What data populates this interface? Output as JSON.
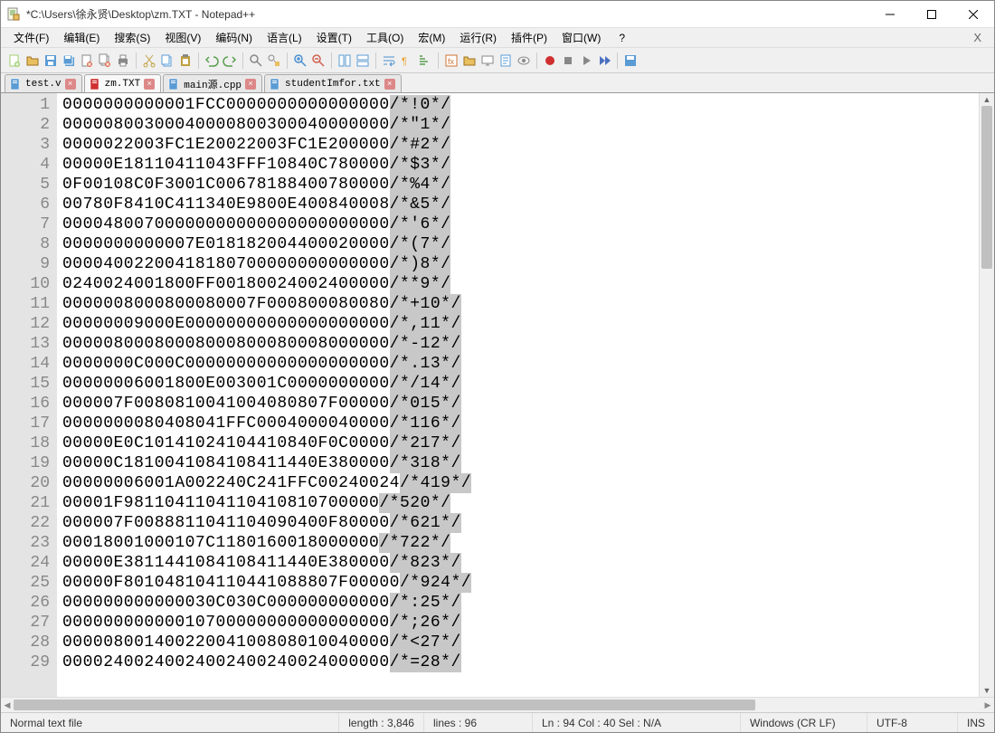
{
  "titlebar": {
    "title": "*C:\\Users\\徐永贤\\Desktop\\zm.TXT - Notepad++"
  },
  "menu": {
    "items": [
      "文件(F)",
      "编辑(E)",
      "搜索(S)",
      "视图(V)",
      "编码(N)",
      "语言(L)",
      "设置(T)",
      "工具(O)",
      "宏(M)",
      "运行(R)",
      "插件(P)",
      "窗口(W)"
    ],
    "help": "?"
  },
  "tabs": [
    {
      "label": "test.v",
      "active": false,
      "unsaved": false
    },
    {
      "label": "zm.TXT",
      "active": true,
      "unsaved": true
    },
    {
      "label": "main源.cpp",
      "active": false,
      "unsaved": false
    },
    {
      "label": "studentImfor.txt",
      "active": false,
      "unsaved": false
    }
  ],
  "lines": [
    {
      "n": 1,
      "hex": "0000000000001FCC0000000000000000",
      "c": "/*!0*/"
    },
    {
      "n": 2,
      "hex": "00000800300040000800300040000000",
      "c": "/*\"1*/"
    },
    {
      "n": 3,
      "hex": "0000022003FC1E20022003FC1E200000",
      "c": "/*#2*/"
    },
    {
      "n": 4,
      "hex": "00000E18110411043FFF10840C780000",
      "c": "/*$3*/"
    },
    {
      "n": 5,
      "hex": "0F00108C0F3001C00678188400780000",
      "c": "/*%4*/"
    },
    {
      "n": 6,
      "hex": "00780F8410C411340E9800E400840008",
      "c": "/*&5*/"
    },
    {
      "n": 7,
      "hex": "00004800700000000000000000000000",
      "c": "/*'6*/"
    },
    {
      "n": 8,
      "hex": "0000000000007E018182004400020000",
      "c": "/*(7*/"
    },
    {
      "n": 9,
      "hex": "00004002200418180700000000000000",
      "c": "/*)8*/"
    },
    {
      "n": 10,
      "hex": "0240024001800FF00180024002400000",
      "c": "/**9*/"
    },
    {
      "n": 11,
      "hex": "0000008000800080007F000800080080",
      "c": "/*+10*/"
    },
    {
      "n": 12,
      "hex": "00000009000E00000000000000000000",
      "c": "/*,11*/"
    },
    {
      "n": 13,
      "hex": "00000800080008000800080008000000",
      "c": "/*-12*/"
    },
    {
      "n": 14,
      "hex": "0000000C000C00000000000000000000",
      "c": "/*.13*/"
    },
    {
      "n": 15,
      "hex": "00000006001800E003001C0000000000",
      "c": "/*/14*/"
    },
    {
      "n": 16,
      "hex": "000007F0080810041004080807F00000",
      "c": "/*015*/"
    },
    {
      "n": 17,
      "hex": "0000000080408041FFC0004000040000",
      "c": "/*116*/"
    },
    {
      "n": 18,
      "hex": "00000E0C10141024104410840F0C0000",
      "c": "/*217*/"
    },
    {
      "n": 19,
      "hex": "00000C1810041084108411440E380000",
      "c": "/*318*/"
    },
    {
      "n": 20,
      "hex": "00000006001A002240C241FFC00240024",
      "c": "/*419*/"
    },
    {
      "n": 21,
      "hex": "00001F9811041104110410810700000",
      "c": "/*520*/"
    },
    {
      "n": 22,
      "hex": "000007F0088811041104090400F80000",
      "c": "/*621*/"
    },
    {
      "n": 23,
      "hex": "00018001000107C1180160018000000",
      "c": "/*722*/"
    },
    {
      "n": 24,
      "hex": "00000E3811441084108411440E380000",
      "c": "/*823*/"
    },
    {
      "n": 25,
      "hex": "00000F801048104110441088807F00000",
      "c": "/*924*/"
    },
    {
      "n": 26,
      "hex": "000000000000030C030C000000000000",
      "c": "/*:25*/"
    },
    {
      "n": 27,
      "hex": "00000000000010700000000000000000",
      "c": "/*;26*/"
    },
    {
      "n": 28,
      "hex": "00000800140022004100808010040000",
      "c": "/*<27*/"
    },
    {
      "n": 29,
      "hex": "00002400240024002400240024000000",
      "c": "/*=28*/"
    }
  ],
  "status": {
    "filetype": "Normal text file",
    "length": "length : 3,846",
    "lines": "lines : 96",
    "pos": "Ln : 94    Col : 40    Sel : N/A",
    "eol": "Windows (CR LF)",
    "enc": "UTF-8",
    "ins": "INS"
  },
  "toolbar_icons": [
    "new-file",
    "open-file",
    "save-file",
    "save-all",
    "close-file",
    "close-all",
    "print",
    "sep",
    "cut",
    "copy",
    "paste",
    "sep",
    "undo",
    "redo",
    "sep",
    "find",
    "replace",
    "sep",
    "zoom-in",
    "zoom-out",
    "sep",
    "sync-v",
    "sync-h",
    "sep",
    "wordwrap",
    "show-all",
    "indent-guide",
    "sep",
    "lang",
    "folder",
    "monitor",
    "doc",
    "eye",
    "sep",
    "record",
    "stop",
    "play",
    "play-multi",
    "sep",
    "save-macro"
  ],
  "colors": {
    "tb": {
      "new": "#9fcf6f",
      "open": "#e8c060",
      "save": "#5a9bd4",
      "saveall": "#5a9bd4",
      "close": "#e07050",
      "closeall": "#e07050",
      "print": "#888",
      "cut": "#c0a040",
      "copy": "#5a9bd4",
      "paste": "#c0a040",
      "undo": "#5aa050",
      "redo": "#5aa050",
      "find": "#888",
      "replace": "#888",
      "zin": "#4a90d0",
      "zout": "#d06050",
      "sv": "#5a9bd4",
      "sh": "#5a9bd4",
      "ww": "#4a90d0",
      "sa": "#e8a030",
      "ig": "#5aa050",
      "lang": "#d07030",
      "folder": "#e8c060",
      "mon": "#888",
      "doc": "#5a9bd4",
      "eye": "#888",
      "rec": "#d03030",
      "stop": "#888",
      "play": "#888",
      "playm": "#4a70c0",
      "sm": "#5a9bd4"
    }
  }
}
